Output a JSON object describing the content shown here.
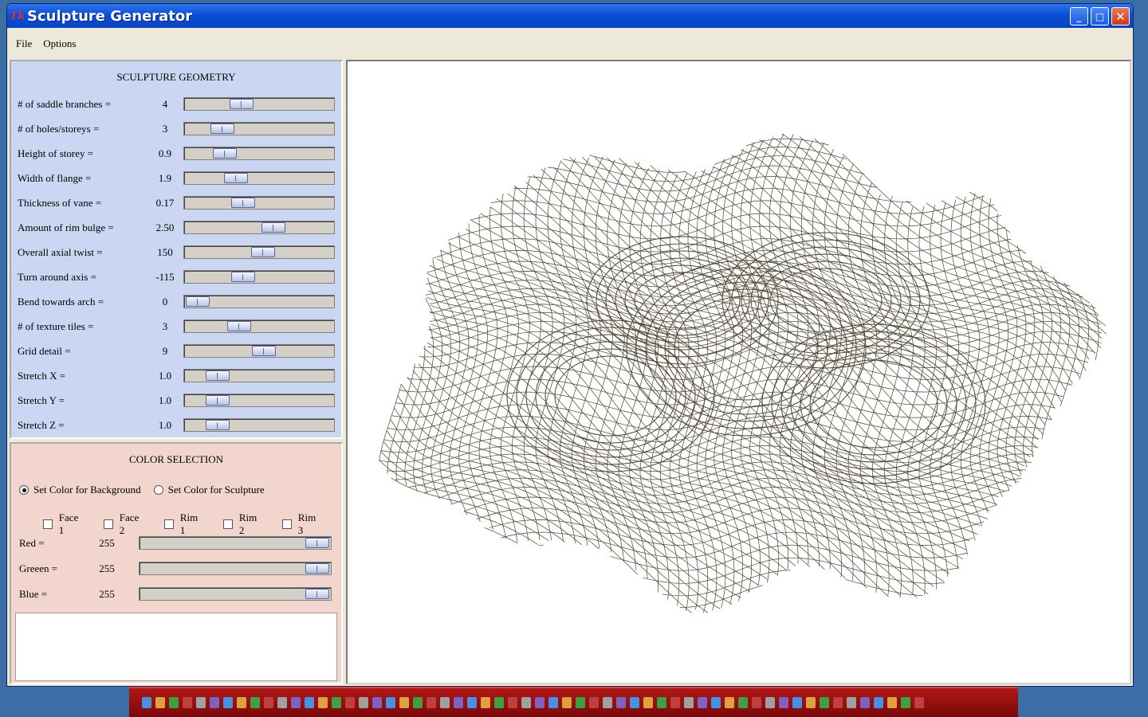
{
  "window": {
    "title": "Sculpture Generator",
    "app_icon": "Tk"
  },
  "titlebar_buttons": {
    "minimize": "_",
    "maximize": "□",
    "close": "✕"
  },
  "menu": [
    {
      "label": "File"
    },
    {
      "label": "Options"
    }
  ],
  "geometry": {
    "title": "SCULPTURE GEOMETRY",
    "params": [
      {
        "label": "# of saddle branches =",
        "value": "4",
        "level": 0.36
      },
      {
        "label": "# of holes/storeys =",
        "value": "3",
        "level": 0.2
      },
      {
        "label": "Height of storey =",
        "value": "0.9",
        "level": 0.22
      },
      {
        "label": "Width of flange =",
        "value": "1.9",
        "level": 0.31
      },
      {
        "label": "Thickness of vane =",
        "value": "0.17",
        "level": 0.37
      },
      {
        "label": "Amount of rim bulge =",
        "value": "2.50",
        "level": 0.62
      },
      {
        "label": "Overall axial twist =",
        "value": "150",
        "level": 0.53
      },
      {
        "label": "Turn around axis =",
        "value": "-115",
        "level": 0.37
      },
      {
        "label": "Bend towards arch =",
        "value": "0",
        "level": 0.0
      },
      {
        "label": "# of texture tiles =",
        "value": "3",
        "level": 0.34
      },
      {
        "label": "Grid detail =",
        "value": "9",
        "level": 0.54
      },
      {
        "label": "Stretch X =",
        "value": "1.0",
        "level": 0.16
      },
      {
        "label": "Stretch  Y =",
        "value": "1.0",
        "level": 0.16
      },
      {
        "label": "Stretch Z =",
        "value": "1.0",
        "level": 0.16
      }
    ]
  },
  "color": {
    "title": "COLOR SELECTION",
    "radio_background": "Set Color for Background",
    "radio_sculpture": "Set Color for Sculpture",
    "checks": [
      {
        "label": "Face 1"
      },
      {
        "label": "Face 2"
      },
      {
        "label": "Rim 1"
      },
      {
        "label": "Rim 2"
      },
      {
        "label": "Rim 3"
      }
    ],
    "channels": [
      {
        "label": "Red =",
        "value": "255",
        "level": 1.0
      },
      {
        "label": "Greeen =",
        "value": "255",
        "level": 1.0
      },
      {
        "label": "Blue =",
        "value": "255",
        "level": 1.0
      }
    ]
  },
  "colors": {
    "geometry_panel": "#cbd6f3",
    "color_panel": "#f2d5cc",
    "wire": "#4a4530",
    "titlebar": "#0a4fd6"
  }
}
